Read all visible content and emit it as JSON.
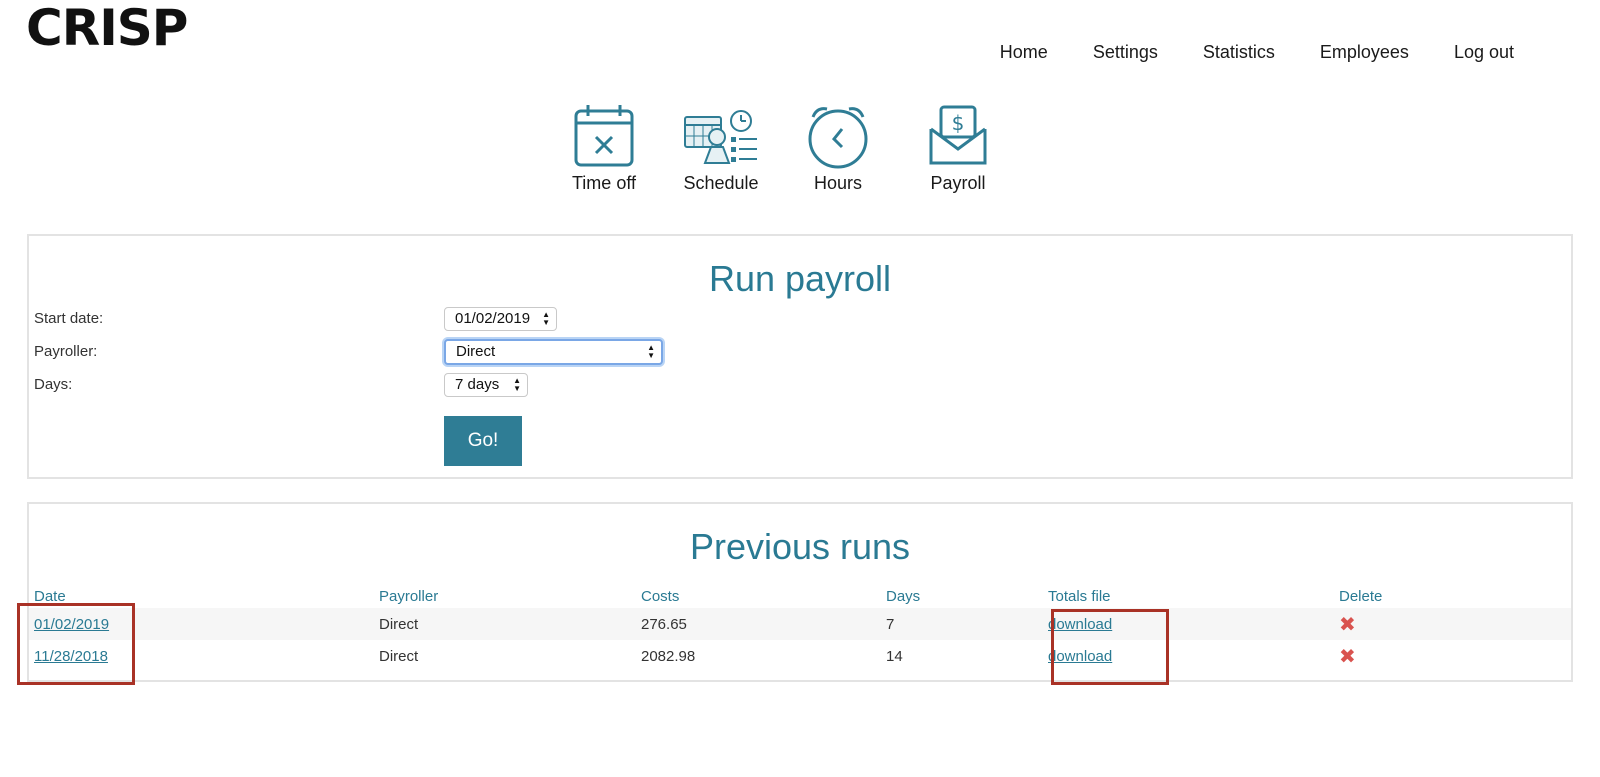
{
  "brand": {
    "logo": "CRISP"
  },
  "nav": [
    "Home",
    "Settings",
    "Statistics",
    "Employees",
    "Log out"
  ],
  "icons": [
    {
      "name": "time-off-icon",
      "label": "Time off"
    },
    {
      "name": "schedule-icon",
      "label": "Schedule"
    },
    {
      "name": "clock-icon",
      "label": "Hours"
    },
    {
      "name": "payroll-envelope-icon",
      "label": "Payroll"
    }
  ],
  "run_payroll": {
    "title": "Run payroll",
    "start_date_label": "Start date:",
    "start_date_value": "01/02/2019",
    "payroller_label": "Payroller:",
    "payroller_value": "Direct",
    "days_label": "Days:",
    "days_value": "7 days",
    "go_label": "Go!"
  },
  "previous_runs": {
    "title": "Previous runs",
    "columns": [
      "Date",
      "Payroller",
      "Costs",
      "Days",
      "Totals file",
      "Delete"
    ],
    "rows": [
      {
        "date": "01/02/2019",
        "payroller": "Direct",
        "costs": "276.65",
        "days": "7",
        "file": "download",
        "delete": "✖"
      },
      {
        "date": "11/28/2018",
        "payroller": "Direct",
        "costs": "2082.98",
        "days": "14",
        "file": "download",
        "delete": "✖"
      }
    ]
  },
  "colors": {
    "accent": "#2a7a93",
    "button": "#2f7d95",
    "delete": "#d9534f",
    "highlight": "#a93226"
  }
}
